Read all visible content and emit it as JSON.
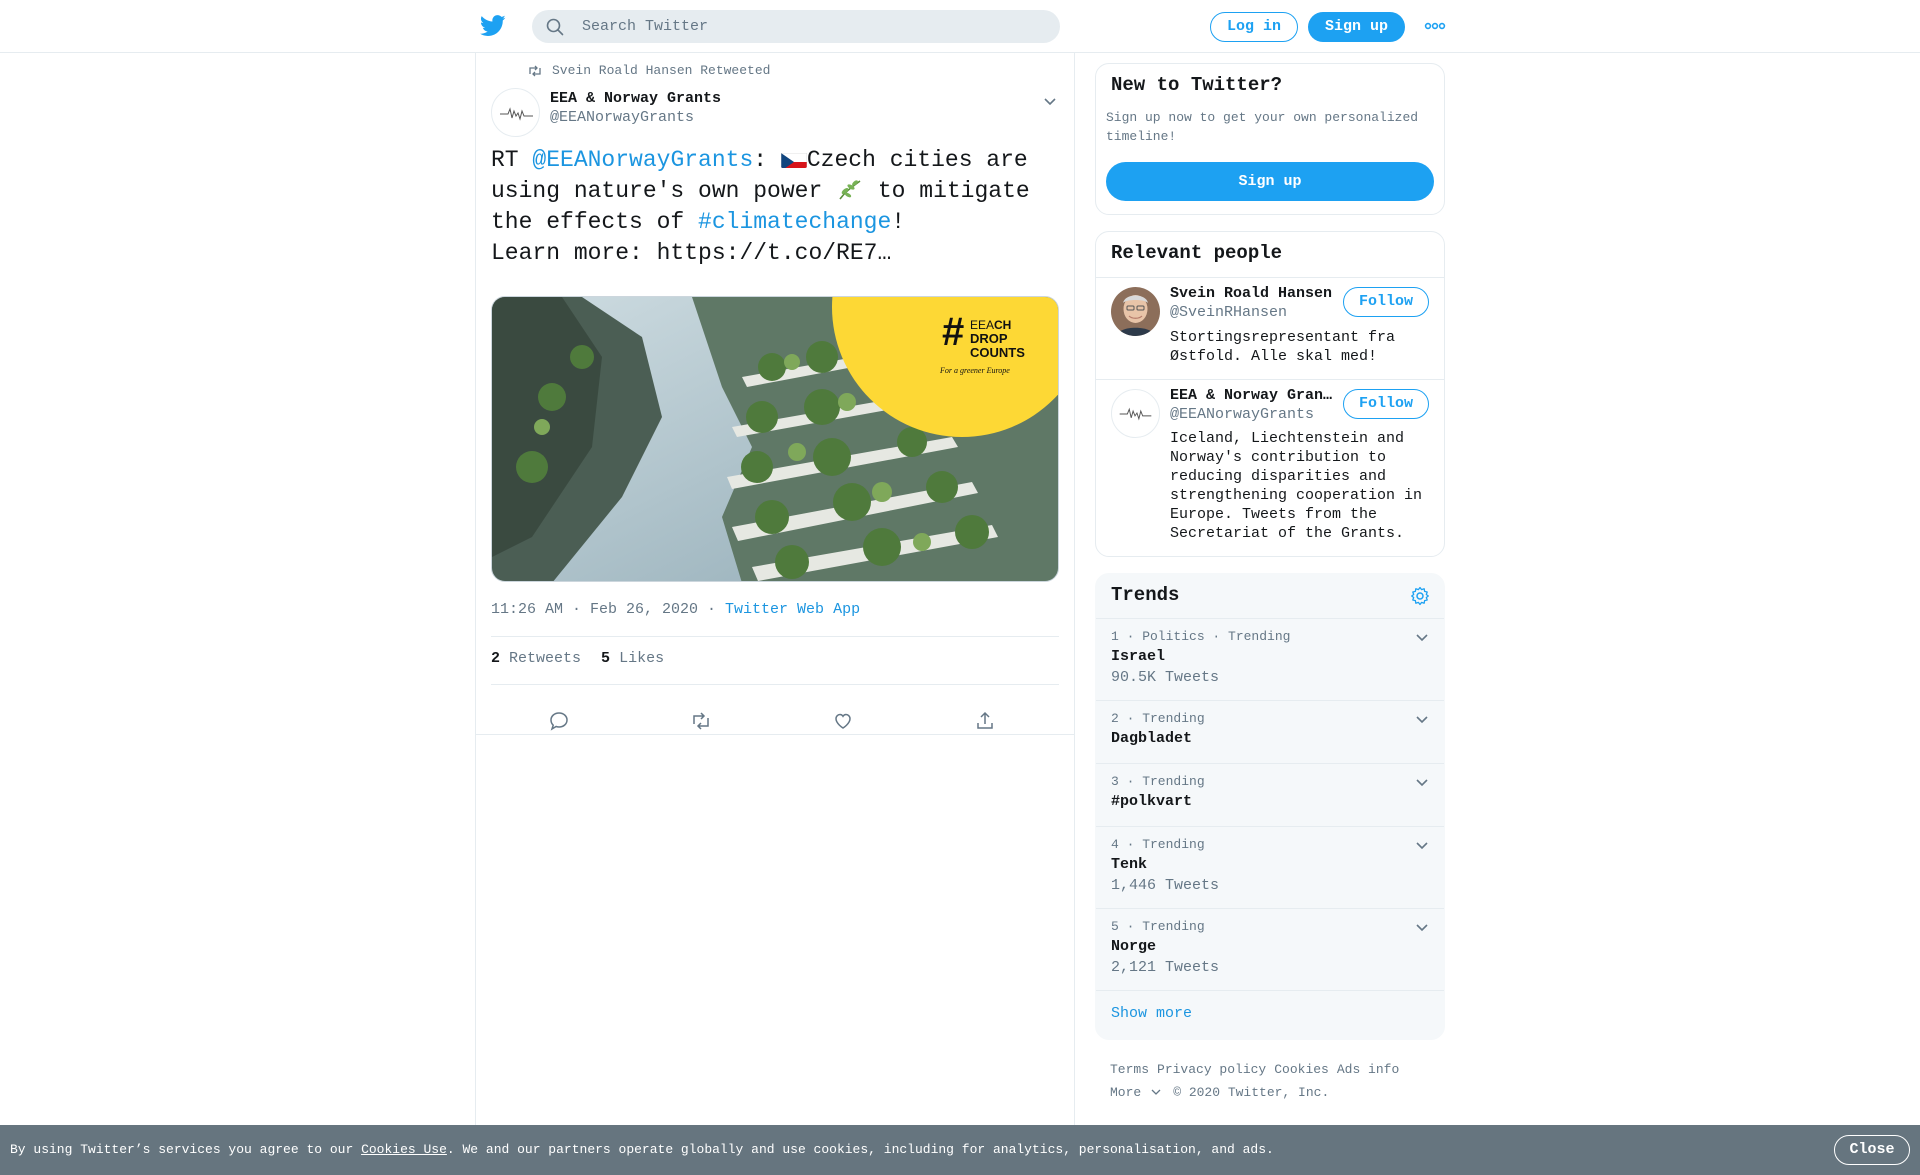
{
  "header": {
    "search_placeholder": "Search Twitter",
    "login_label": "Log in",
    "signup_label": "Sign up",
    "more_icon": "more-dots-icon",
    "logo_icon": "twitter-bird-icon"
  },
  "tweet": {
    "retweet_context": "Svein Roald Hansen Retweeted",
    "author_name": "EEA & Norway Grants",
    "author_handle": "@EEANorwayGrants",
    "text_prefix": "RT ",
    "mention": "@EEANorwayGrants",
    "text_part1": ": ",
    "text_part2": "Czech cities are using nature's own power ",
    "text_part3": " to mitigate the effects of ",
    "hashtag": "#climatechange",
    "text_part4": "!",
    "text_line_last": "Learn more: https://t.co/RE7…",
    "media_badge_line1_a": "EEA",
    "media_badge_line1_b": "CH",
    "media_badge_line2": "DROP",
    "media_badge_line3": "COUNTS",
    "media_badge_tagline": "For a greener Europe",
    "timestamp": "11:26 AM · Feb 26, 2020 · ",
    "source": "Twitter Web App",
    "retweets_count": "2",
    "retweets_label": "Retweets",
    "likes_count": "5",
    "likes_label": "Likes"
  },
  "sidebar": {
    "new_to_twitter": {
      "title": "New to Twitter?",
      "text": "Sign up now to get your own personalized timeline!",
      "button": "Sign up"
    },
    "relevant_people": {
      "title": "Relevant people",
      "people": [
        {
          "name": "Svein Roald Hansen",
          "handle": "@SveinRHansen",
          "bio": "Stortingsrepresentant fra Østfold. Alle skal med!",
          "follow": "Follow"
        },
        {
          "name": "EEA & Norway Grants",
          "handle": "@EEANorwayGrants",
          "bio": "Iceland, Liechtenstein and Norway's contribution to reducing disparities and strengthening cooperation in Europe. Tweets from the Secretariat of the Grants.",
          "follow": "Follow"
        }
      ]
    },
    "trends": {
      "title": "Trends",
      "items": [
        {
          "meta": "1 · Politics · Trending",
          "name": "Israel",
          "count": "90.5K Tweets"
        },
        {
          "meta": "2 · Trending",
          "name": "Dagbladet",
          "count": ""
        },
        {
          "meta": "3 · Trending",
          "name": "#polkvart",
          "count": ""
        },
        {
          "meta": "4 · Trending",
          "name": "Tenk",
          "count": "1,446 Tweets"
        },
        {
          "meta": "5 · Trending",
          "name": "Norge",
          "count": "2,121 Tweets"
        }
      ],
      "show_more": "Show more"
    },
    "footer": {
      "terms": "Terms",
      "privacy": "Privacy policy",
      "cookies": "Cookies",
      "ads": "Ads info",
      "more": "More",
      "copyright": "© 2020 Twitter, Inc."
    }
  },
  "cookie_banner": {
    "text_before": "By using Twitter’s services you agree to our ",
    "link": "Cookies Use",
    "text_after": ". We and our partners operate globally and use cookies, including for analytics, personalisation, and ads.",
    "close": "Close"
  },
  "colors": {
    "accent": "#1da1f2",
    "link": "#1b95e0",
    "secondary_text": "#657786",
    "banner": "#66757f"
  }
}
